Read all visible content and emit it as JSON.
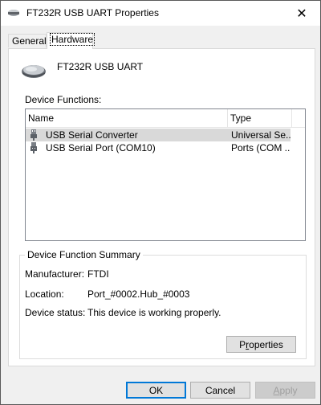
{
  "window": {
    "title": "FT232R USB UART Properties",
    "close_glyph": "✕"
  },
  "tabs": [
    {
      "label": "General",
      "selected": false
    },
    {
      "label": "Hardware",
      "selected": true
    }
  ],
  "device": {
    "name": "FT232R USB UART",
    "icon": "mouse-icon"
  },
  "functions": {
    "label": "Device Functions:",
    "columns": [
      "Name",
      "Type"
    ],
    "rows": [
      {
        "name": "USB Serial Converter",
        "type": "Universal Se...",
        "selected": true,
        "icon": "usb-plug-icon"
      },
      {
        "name": "USB Serial Port (COM10)",
        "type": "Ports (COM ...",
        "selected": false,
        "icon": "serial-port-icon"
      }
    ]
  },
  "summary": {
    "legend": "Device Function Summary",
    "manufacturer_label": "Manufacturer:",
    "manufacturer_value": "FTDI",
    "location_label": "Location:",
    "location_value": "Port_#0002.Hub_#0003",
    "status_label": "Device status:",
    "status_value": "This device is working properly.",
    "properties_prefix": "P",
    "properties_underlined": "r",
    "properties_suffix": "operties"
  },
  "buttons": {
    "ok": "OK",
    "cancel": "Cancel",
    "apply_underlined": "A",
    "apply_suffix": "pply"
  },
  "colors": {
    "accent": "#0078d7",
    "selection": "#d9d9d9",
    "disabled_text": "#a0a0a0"
  }
}
